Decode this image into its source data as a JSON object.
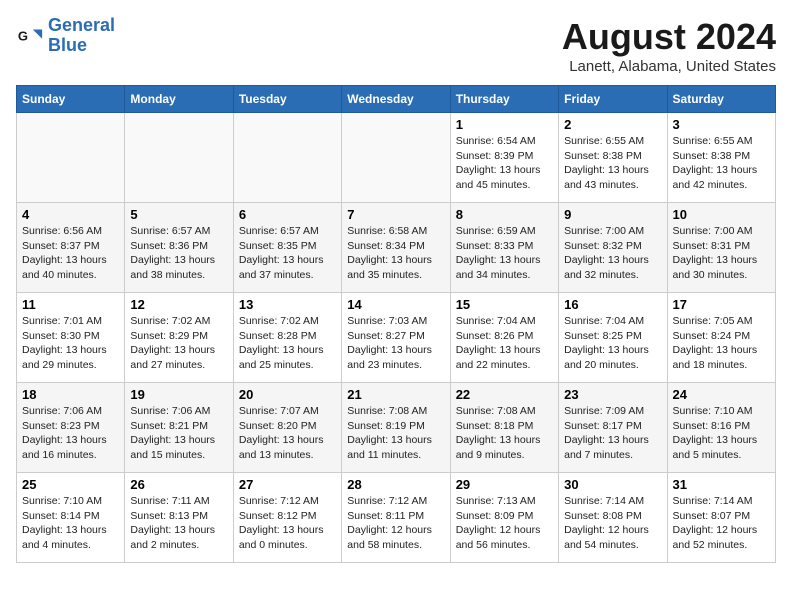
{
  "header": {
    "logo_line1": "General",
    "logo_line2": "Blue",
    "month_year": "August 2024",
    "location": "Lanett, Alabama, United States"
  },
  "weekdays": [
    "Sunday",
    "Monday",
    "Tuesday",
    "Wednesday",
    "Thursday",
    "Friday",
    "Saturday"
  ],
  "weeks": [
    [
      {
        "day": "",
        "info": ""
      },
      {
        "day": "",
        "info": ""
      },
      {
        "day": "",
        "info": ""
      },
      {
        "day": "",
        "info": ""
      },
      {
        "day": "1",
        "info": "Sunrise: 6:54 AM\nSunset: 8:39 PM\nDaylight: 13 hours\nand 45 minutes."
      },
      {
        "day": "2",
        "info": "Sunrise: 6:55 AM\nSunset: 8:38 PM\nDaylight: 13 hours\nand 43 minutes."
      },
      {
        "day": "3",
        "info": "Sunrise: 6:55 AM\nSunset: 8:38 PM\nDaylight: 13 hours\nand 42 minutes."
      }
    ],
    [
      {
        "day": "4",
        "info": "Sunrise: 6:56 AM\nSunset: 8:37 PM\nDaylight: 13 hours\nand 40 minutes."
      },
      {
        "day": "5",
        "info": "Sunrise: 6:57 AM\nSunset: 8:36 PM\nDaylight: 13 hours\nand 38 minutes."
      },
      {
        "day": "6",
        "info": "Sunrise: 6:57 AM\nSunset: 8:35 PM\nDaylight: 13 hours\nand 37 minutes."
      },
      {
        "day": "7",
        "info": "Sunrise: 6:58 AM\nSunset: 8:34 PM\nDaylight: 13 hours\nand 35 minutes."
      },
      {
        "day": "8",
        "info": "Sunrise: 6:59 AM\nSunset: 8:33 PM\nDaylight: 13 hours\nand 34 minutes."
      },
      {
        "day": "9",
        "info": "Sunrise: 7:00 AM\nSunset: 8:32 PM\nDaylight: 13 hours\nand 32 minutes."
      },
      {
        "day": "10",
        "info": "Sunrise: 7:00 AM\nSunset: 8:31 PM\nDaylight: 13 hours\nand 30 minutes."
      }
    ],
    [
      {
        "day": "11",
        "info": "Sunrise: 7:01 AM\nSunset: 8:30 PM\nDaylight: 13 hours\nand 29 minutes."
      },
      {
        "day": "12",
        "info": "Sunrise: 7:02 AM\nSunset: 8:29 PM\nDaylight: 13 hours\nand 27 minutes."
      },
      {
        "day": "13",
        "info": "Sunrise: 7:02 AM\nSunset: 8:28 PM\nDaylight: 13 hours\nand 25 minutes."
      },
      {
        "day": "14",
        "info": "Sunrise: 7:03 AM\nSunset: 8:27 PM\nDaylight: 13 hours\nand 23 minutes."
      },
      {
        "day": "15",
        "info": "Sunrise: 7:04 AM\nSunset: 8:26 PM\nDaylight: 13 hours\nand 22 minutes."
      },
      {
        "day": "16",
        "info": "Sunrise: 7:04 AM\nSunset: 8:25 PM\nDaylight: 13 hours\nand 20 minutes."
      },
      {
        "day": "17",
        "info": "Sunrise: 7:05 AM\nSunset: 8:24 PM\nDaylight: 13 hours\nand 18 minutes."
      }
    ],
    [
      {
        "day": "18",
        "info": "Sunrise: 7:06 AM\nSunset: 8:23 PM\nDaylight: 13 hours\nand 16 minutes."
      },
      {
        "day": "19",
        "info": "Sunrise: 7:06 AM\nSunset: 8:21 PM\nDaylight: 13 hours\nand 15 minutes."
      },
      {
        "day": "20",
        "info": "Sunrise: 7:07 AM\nSunset: 8:20 PM\nDaylight: 13 hours\nand 13 minutes."
      },
      {
        "day": "21",
        "info": "Sunrise: 7:08 AM\nSunset: 8:19 PM\nDaylight: 13 hours\nand 11 minutes."
      },
      {
        "day": "22",
        "info": "Sunrise: 7:08 AM\nSunset: 8:18 PM\nDaylight: 13 hours\nand 9 minutes."
      },
      {
        "day": "23",
        "info": "Sunrise: 7:09 AM\nSunset: 8:17 PM\nDaylight: 13 hours\nand 7 minutes."
      },
      {
        "day": "24",
        "info": "Sunrise: 7:10 AM\nSunset: 8:16 PM\nDaylight: 13 hours\nand 5 minutes."
      }
    ],
    [
      {
        "day": "25",
        "info": "Sunrise: 7:10 AM\nSunset: 8:14 PM\nDaylight: 13 hours\nand 4 minutes."
      },
      {
        "day": "26",
        "info": "Sunrise: 7:11 AM\nSunset: 8:13 PM\nDaylight: 13 hours\nand 2 minutes."
      },
      {
        "day": "27",
        "info": "Sunrise: 7:12 AM\nSunset: 8:12 PM\nDaylight: 13 hours\nand 0 minutes."
      },
      {
        "day": "28",
        "info": "Sunrise: 7:12 AM\nSunset: 8:11 PM\nDaylight: 12 hours\nand 58 minutes."
      },
      {
        "day": "29",
        "info": "Sunrise: 7:13 AM\nSunset: 8:09 PM\nDaylight: 12 hours\nand 56 minutes."
      },
      {
        "day": "30",
        "info": "Sunrise: 7:14 AM\nSunset: 8:08 PM\nDaylight: 12 hours\nand 54 minutes."
      },
      {
        "day": "31",
        "info": "Sunrise: 7:14 AM\nSunset: 8:07 PM\nDaylight: 12 hours\nand 52 minutes."
      }
    ]
  ]
}
